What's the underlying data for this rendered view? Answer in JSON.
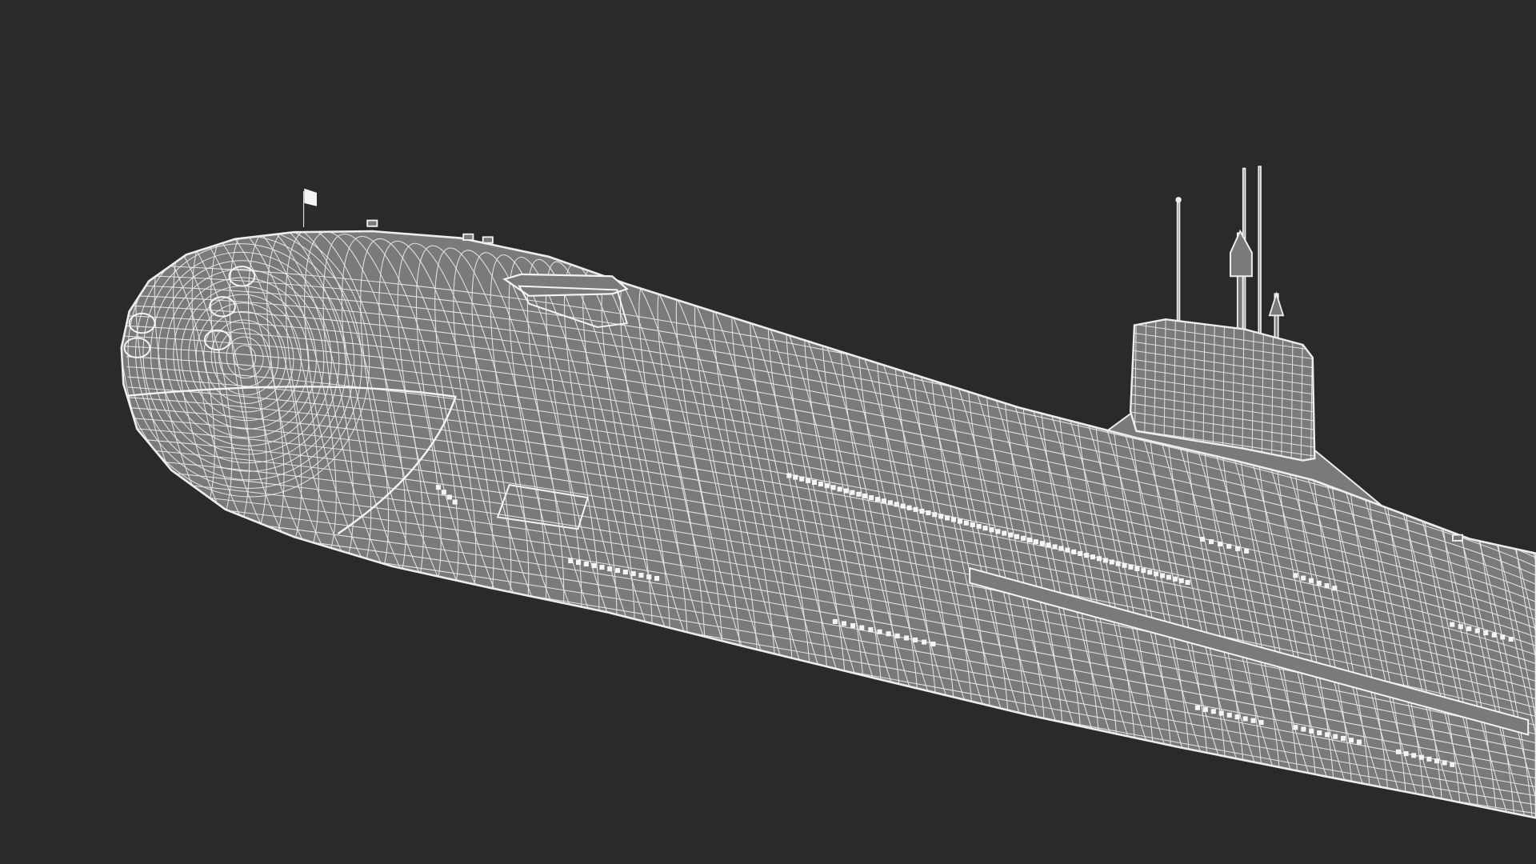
{
  "scene": {
    "subject": "submarine-wireframe-render",
    "background_color": "#2a2a2a",
    "hull_fill": "#7a7a7a",
    "wire_color": "#ededed",
    "detail_color": "#f4f4f4"
  }
}
